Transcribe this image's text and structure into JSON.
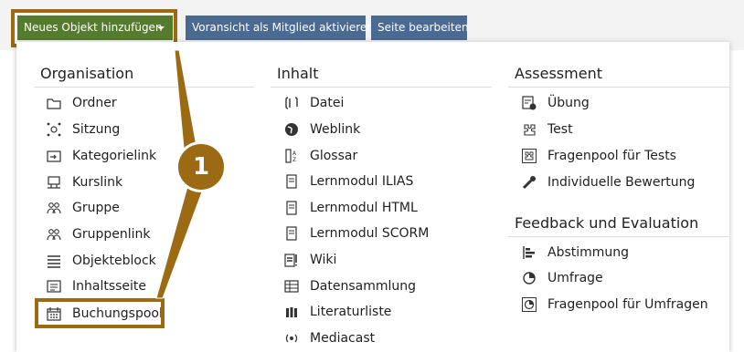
{
  "toolbar": {
    "add_object": "Neues Objekt hinzufügen",
    "preview_member": "Voransicht als Mitglied aktivieren",
    "edit_page": "Seite bearbeiten"
  },
  "callout_number": "1",
  "columns": {
    "organisation": {
      "title": "Organisation",
      "items": [
        {
          "label": "Ordner",
          "icon": "folder-icon"
        },
        {
          "label": "Sitzung",
          "icon": "session-icon"
        },
        {
          "label": "Kategorielink",
          "icon": "category-link-icon"
        },
        {
          "label": "Kurslink",
          "icon": "course-link-icon"
        },
        {
          "label": "Gruppe",
          "icon": "group-icon"
        },
        {
          "label": "Gruppenlink",
          "icon": "group-link-icon"
        },
        {
          "label": "Objekteblock",
          "icon": "object-block-icon"
        },
        {
          "label": "Inhaltsseite",
          "icon": "content-page-icon"
        },
        {
          "label": "Buchungspool",
          "icon": "booking-pool-icon"
        }
      ]
    },
    "inhalt": {
      "title": "Inhalt",
      "items": [
        {
          "label": "Datei",
          "icon": "file-icon"
        },
        {
          "label": "Weblink",
          "icon": "weblink-icon"
        },
        {
          "label": "Glossar",
          "icon": "glossary-icon"
        },
        {
          "label": "Lernmodul ILIAS",
          "icon": "learning-module-icon"
        },
        {
          "label": "Lernmodul HTML",
          "icon": "learning-module-icon"
        },
        {
          "label": "Lernmodul SCORM",
          "icon": "learning-module-icon"
        },
        {
          "label": "Wiki",
          "icon": "wiki-icon"
        },
        {
          "label": "Datensammlung",
          "icon": "data-collection-icon"
        },
        {
          "label": "Literaturliste",
          "icon": "bibliography-icon"
        },
        {
          "label": "Mediacast",
          "icon": "mediacast-icon"
        }
      ]
    },
    "assessment": {
      "title": "Assessment",
      "items": [
        {
          "label": "Übung",
          "icon": "exercise-icon"
        },
        {
          "label": "Test",
          "icon": "test-icon"
        },
        {
          "label": "Fragenpool für Tests",
          "icon": "question-pool-icon"
        },
        {
          "label": "Individuelle Bewertung",
          "icon": "individual-assessment-icon"
        }
      ]
    },
    "feedback": {
      "title": "Feedback und Evaluation",
      "items": [
        {
          "label": "Abstimmung",
          "icon": "poll-icon"
        },
        {
          "label": "Umfrage",
          "icon": "survey-icon"
        },
        {
          "label": "Fragenpool für Umfragen",
          "icon": "survey-pool-icon"
        }
      ]
    }
  },
  "colors": {
    "primary_button": "#557b2e",
    "secondary_button": "#4a6a92",
    "highlight": "#9b6a13"
  }
}
